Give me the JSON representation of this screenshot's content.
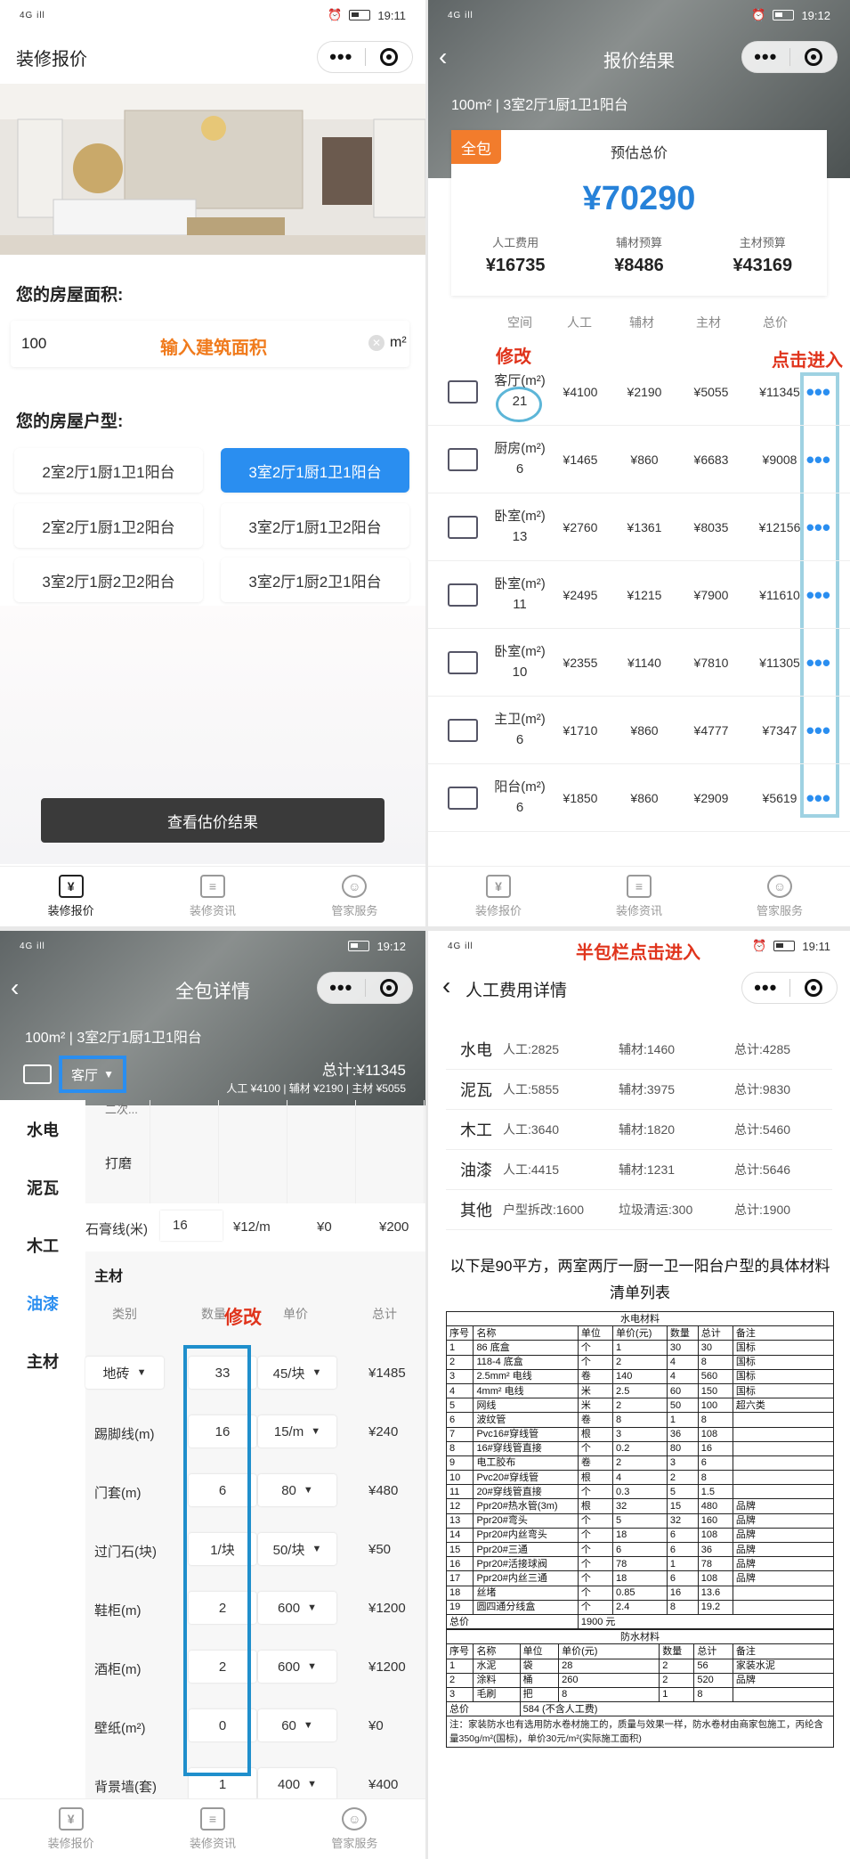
{
  "status": {
    "signal": "4G ill",
    "p1_time": "19:11",
    "p2_time": "19:12",
    "p3_time": "19:12",
    "p4_time": "19:11"
  },
  "p1": {
    "title": "装修报价",
    "area_label": "您的房屋面积:",
    "area_value": "100",
    "area_hint": "输入建筑面积",
    "area_unit": "m²",
    "layout_label": "您的房屋户型:",
    "layouts": [
      "2室2厅1厨1卫1阳台",
      "3室2厅1厨1卫1阳台",
      "2室2厅1厨1卫2阳台",
      "3室2厅1厨1卫2阳台",
      "3室2厅1厨2卫2阳台",
      "3室2厅1厨2卫1阳台"
    ],
    "submit": "查看估价结果"
  },
  "tabs": [
    "装修报价",
    "装修资讯",
    "管家服务"
  ],
  "p2": {
    "title": "报价结果",
    "summary": "100m² | 3室2厅1厨1卫1阳台",
    "badge": "全包",
    "est_label": "预估总价",
    "total": "¥70290",
    "sub": [
      {
        "label": "人工费用",
        "value": "¥16735"
      },
      {
        "label": "辅材预算",
        "value": "¥8486"
      },
      {
        "label": "主材预算",
        "value": "¥43169"
      }
    ],
    "headers": [
      "空间",
      "人工",
      "辅材",
      "主材",
      "总价"
    ],
    "rows": [
      {
        "name": "客厅(m²)",
        "area": "21",
        "labor": "¥4100",
        "aux": "¥2190",
        "main": "¥5055",
        "total": "¥11345"
      },
      {
        "name": "厨房(m²)",
        "area": "6",
        "labor": "¥1465",
        "aux": "¥860",
        "main": "¥6683",
        "total": "¥9008"
      },
      {
        "name": "卧室(m²)",
        "area": "13",
        "labor": "¥2760",
        "aux": "¥1361",
        "main": "¥8035",
        "total": "¥12156"
      },
      {
        "name": "卧室(m²)",
        "area": "11",
        "labor": "¥2495",
        "aux": "¥1215",
        "main": "¥7900",
        "total": "¥11610"
      },
      {
        "name": "卧室(m²)",
        "area": "10",
        "labor": "¥2355",
        "aux": "¥1140",
        "main": "¥7810",
        "total": "¥11305"
      },
      {
        "name": "主卫(m²)",
        "area": "6",
        "labor": "¥1710",
        "aux": "¥860",
        "main": "¥4777",
        "total": "¥7347"
      },
      {
        "name": "阳台(m²)",
        "area": "6",
        "labor": "¥1850",
        "aux": "¥860",
        "main": "¥2909",
        "total": "¥5619"
      }
    ],
    "annot_modify": "修改",
    "annot_click": "点击进入",
    "more": "•••"
  },
  "p3": {
    "title": "全包详情",
    "summary": "100m² | 3室2厅1厨1卫1阳台",
    "room": "客厅",
    "total": "总计:¥11345",
    "breakdown": "人工 ¥4100  |  辅材 ¥2190  |  主材 ¥5055",
    "menu": [
      "水电",
      "泥瓦",
      "木工",
      "油漆",
      "主材"
    ],
    "prev_cut": "二次...",
    "polish": "打磨",
    "gypsum": {
      "name": "石膏线(米)",
      "qty": "16",
      "unit": "¥12/m",
      "v": "¥0",
      "total": "¥200"
    },
    "main_title": "主材",
    "headers": [
      "类别",
      "数量",
      "单价",
      "总计"
    ],
    "annot_modify": "修改",
    "items": [
      {
        "name": "地砖",
        "qty": "33",
        "price": "45/块",
        "total": "¥1485",
        "dd": true
      },
      {
        "name": "踢脚线(m)",
        "qty": "16",
        "price": "15/m",
        "total": "¥240"
      },
      {
        "name": "门套(m)",
        "qty": "6",
        "price": "80",
        "total": "¥480"
      },
      {
        "name": "过门石(块)",
        "qty": "1/块",
        "price": "50/块",
        "total": "¥50"
      },
      {
        "name": "鞋柜(m)",
        "qty": "2",
        "price": "600",
        "total": "¥1200"
      },
      {
        "name": "酒柜(m)",
        "qty": "2",
        "price": "600",
        "total": "¥1200"
      },
      {
        "name": "壁纸(m²)",
        "qty": "0",
        "price": "60",
        "total": "¥0"
      },
      {
        "name": "背景墙(套)",
        "qty": "1",
        "price": "400",
        "total": "¥400"
      }
    ]
  },
  "p4": {
    "title": "人工费用详情",
    "annot": "半包栏点击进入",
    "labor": [
      {
        "name": "水电",
        "a": "人工:2825",
        "b": "辅材:1460",
        "c": "总计:4285"
      },
      {
        "name": "泥瓦",
        "a": "人工:5855",
        "b": "辅材:3975",
        "c": "总计:9830"
      },
      {
        "name": "木工",
        "a": "人工:3640",
        "b": "辅材:1820",
        "c": "总计:5460"
      },
      {
        "name": "油漆",
        "a": "人工:4415",
        "b": "辅材:1231",
        "c": "总计:5646"
      },
      {
        "name": "其他",
        "a": "户型拆改:1600",
        "b": "垃圾清运:300",
        "c": "总计:1900"
      }
    ],
    "heading": "以下是90平方，两室两厅一厨一卫一阳台户型的具体材料清单列表",
    "t1_title": "水电材料",
    "t1_head": [
      "序号",
      "名称",
      "单位",
      "单价(元)",
      "数量",
      "总计",
      "备注"
    ],
    "t1_rows": [
      [
        "1",
        "86 底盒",
        "个",
        "1",
        "30",
        "30",
        "国标"
      ],
      [
        "2",
        "118-4 底盒",
        "个",
        "2",
        "4",
        "8",
        "国标"
      ],
      [
        "3",
        "2.5mm² 电线",
        "卷",
        "140",
        "4",
        "560",
        "国标"
      ],
      [
        "4",
        "4mm² 电线",
        "米",
        "2.5",
        "60",
        "150",
        "国标"
      ],
      [
        "5",
        "网线",
        "米",
        "2",
        "50",
        "100",
        "超六类"
      ],
      [
        "6",
        "波纹管",
        "卷",
        "8",
        "1",
        "8",
        ""
      ],
      [
        "7",
        "Pvc16#穿线管",
        "根",
        "3",
        "36",
        "108",
        ""
      ],
      [
        "8",
        "16#穿线管直接",
        "个",
        "0.2",
        "80",
        "16",
        ""
      ],
      [
        "9",
        "电工胶布",
        "卷",
        "2",
        "3",
        "6",
        ""
      ],
      [
        "10",
        "Pvc20#穿线管",
        "根",
        "4",
        "2",
        "8",
        ""
      ],
      [
        "11",
        "20#穿线管直接",
        "个",
        "0.3",
        "5",
        "1.5",
        ""
      ],
      [
        "12",
        "Ppr20#热水管(3m)",
        "根",
        "32",
        "15",
        "480",
        "品牌"
      ],
      [
        "13",
        "Ppr20#弯头",
        "个",
        "5",
        "32",
        "160",
        "品牌"
      ],
      [
        "14",
        "Ppr20#内丝弯头",
        "个",
        "18",
        "6",
        "108",
        "品牌"
      ],
      [
        "15",
        "Ppr20#三通",
        "个",
        "6",
        "6",
        "36",
        "品牌"
      ],
      [
        "16",
        "Ppr20#活接球阀",
        "个",
        "78",
        "1",
        "78",
        "品牌"
      ],
      [
        "17",
        "Ppr20#内丝三通",
        "个",
        "18",
        "6",
        "108",
        "品牌"
      ],
      [
        "18",
        "丝堵",
        "个",
        "0.85",
        "16",
        "13.6",
        ""
      ],
      [
        "19",
        "圆四通分线盒",
        "个",
        "2.4",
        "8",
        "19.2",
        ""
      ]
    ],
    "t1_total_label": "总价",
    "t1_total": "1900 元",
    "t2_title": "防水材料",
    "t2_head": [
      "序号",
      "名称",
      "单位",
      "单价(元)",
      "数量",
      "总计",
      "备注"
    ],
    "t2_rows": [
      [
        "1",
        "水泥",
        "袋",
        "28",
        "2",
        "56",
        "家装水泥"
      ],
      [
        "2",
        "涂料",
        "桶",
        "260",
        "2",
        "520",
        "品牌"
      ],
      [
        "3",
        "毛刷",
        "把",
        "8",
        "1",
        "8",
        ""
      ]
    ],
    "t2_total_label": "总价",
    "t2_total": "584 (不含人工费)",
    "note": "注：家装防水也有选用防水卷材施工的，质量与效果一样，防水卷材由商家包施工，丙纶含量350g/m²(国标)，单价30元/m²(实际施工面积)"
  }
}
